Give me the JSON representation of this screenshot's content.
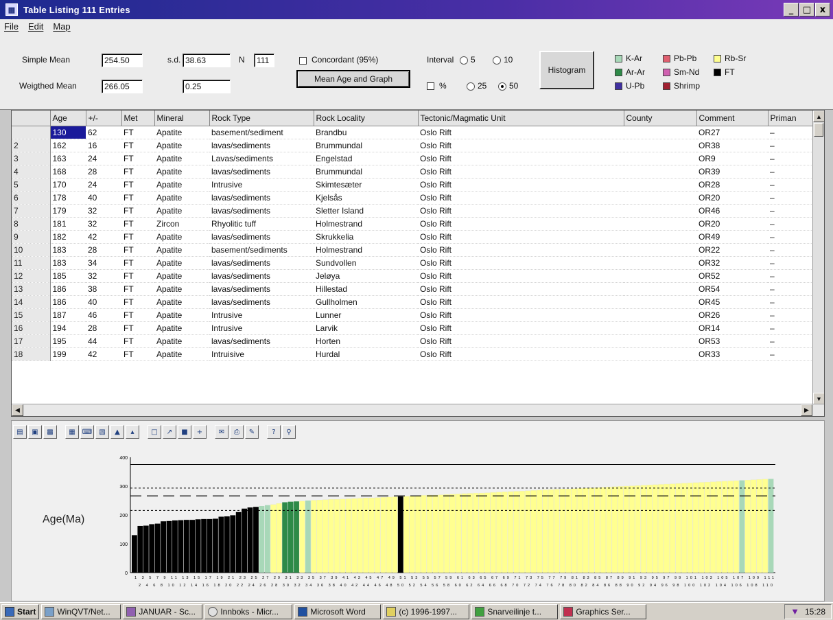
{
  "window": {
    "title": "Table Listing 111 Entries",
    "controls": [
      "_",
      "□",
      "x"
    ]
  },
  "menu": [
    "File",
    "Edit",
    "Map"
  ],
  "stats": {
    "simple_mean_label": "Simple Mean",
    "simple_mean": "254.50",
    "sd_label": "s.d.",
    "sd": "38.63",
    "n_label": "N",
    "n": "111",
    "weighted_mean_label": "Weigthed Mean",
    "weighted_mean": "266.05",
    "weighted_sd": "0.25",
    "concordant_label": "Concordant (95%)",
    "mean_button": "Mean Age and Graph"
  },
  "interval": {
    "label": "Interval",
    "opt5": "5",
    "opt10": "10",
    "opt25": "25",
    "opt50": "50",
    "percent_label": "%",
    "selected": "50"
  },
  "histogram_button": "Histogram",
  "legend": {
    "k_ar": "K-Ar",
    "pb_pb": "Pb-Pb",
    "rb_sr": "Rb-Sr",
    "ar_ar": "Ar-Ar",
    "sm_nd": "Sm-Nd",
    "ft": "FT",
    "u_pb": "U-Pb",
    "shrimp": "Shrimp",
    "colors": {
      "k_ar": "#a8d8b8",
      "pb_pb": "#e06070",
      "rb_sr": "#ffff90",
      "ar_ar": "#2e8a48",
      "sm_nd": "#d060b0",
      "ft": "#000000",
      "u_pb": "#4030a0",
      "shrimp": "#a02030"
    }
  },
  "table": {
    "headers": [
      "Age",
      "+/-",
      "Met",
      "Mineral",
      "Rock Type",
      "Rock Locality",
      "Tectonic/Magmatic Unit",
      "County",
      "Comment",
      "Priman"
    ],
    "rows": [
      [
        "",
        "130",
        "62",
        "FT",
        "Apatite",
        "basement/sediment",
        "Brandbu",
        "Oslo Rift",
        "",
        "OR27",
        "–"
      ],
      [
        "2",
        "162",
        "16",
        "FT",
        "Apatite",
        "lavas/sediments",
        "Brummundal",
        "Oslo Rift",
        "",
        "OR38",
        "–"
      ],
      [
        "3",
        "163",
        "24",
        "FT",
        "Apatite",
        "Lavas/sediments",
        "Engelstad",
        "Oslo Rift",
        "",
        "OR9",
        "–"
      ],
      [
        "4",
        "168",
        "28",
        "FT",
        "Apatite",
        "lavas/sediments",
        "Brummundal",
        "Oslo Rift",
        "",
        "OR39",
        "–"
      ],
      [
        "5",
        "170",
        "24",
        "FT",
        "Apatite",
        "Intrusive",
        "Skimtesæter",
        "Oslo Rift",
        "",
        "OR28",
        "–"
      ],
      [
        "6",
        "178",
        "40",
        "FT",
        "Apatite",
        "lavas/sediments",
        "Kjelsås",
        "Oslo Rift",
        "",
        "OR20",
        "–"
      ],
      [
        "7",
        "179",
        "32",
        "FT",
        "Apatite",
        "lavas/sediments",
        "Sletter Island",
        "Oslo Rift",
        "",
        "OR46",
        "–"
      ],
      [
        "8",
        "181",
        "32",
        "FT",
        "Zircon",
        "Rhyolitic tuff",
        "Holmestrand",
        "Oslo Rift",
        "",
        "OR20",
        "–"
      ],
      [
        "9",
        "182",
        "42",
        "FT",
        "Apatite",
        "lavas/sediments",
        "Skrukkelia",
        "Oslo Rift",
        "",
        "OR49",
        "–"
      ],
      [
        "10",
        "183",
        "28",
        "FT",
        "Apatite",
        "basement/sediments",
        "Holmestrand",
        "Oslo Rift",
        "",
        "OR22",
        "–"
      ],
      [
        "11",
        "183",
        "34",
        "FT",
        "Apatite",
        "lavas/sediments",
        "Sundvollen",
        "Oslo Rift",
        "",
        "OR32",
        "–"
      ],
      [
        "12",
        "185",
        "32",
        "FT",
        "Apatite",
        "lavas/sediments",
        "Jeløya",
        "Oslo Rift",
        "",
        "OR52",
        "–"
      ],
      [
        "13",
        "186",
        "38",
        "FT",
        "Apatite",
        "lavas/sediments",
        "Hillestad",
        "Oslo Rift",
        "",
        "OR54",
        "–"
      ],
      [
        "14",
        "186",
        "40",
        "FT",
        "Apatite",
        "lavas/sediments",
        "Gullholmen",
        "Oslo Rift",
        "",
        "OR45",
        "–"
      ],
      [
        "15",
        "187",
        "46",
        "FT",
        "Apatite",
        "Intrusive",
        "Lunner",
        "Oslo Rift",
        "",
        "OR26",
        "–"
      ],
      [
        "16",
        "194",
        "28",
        "FT",
        "Apatite",
        "Intrusive",
        "Larvik",
        "Oslo Rift",
        "",
        "OR14",
        "–"
      ],
      [
        "17",
        "195",
        "44",
        "FT",
        "Apatite",
        "lavas/sediments",
        "Horten",
        "Oslo Rift",
        "",
        "OR53",
        "–"
      ],
      [
        "18",
        "199",
        "42",
        "FT",
        "Apatite",
        "Intruisive",
        "Hurdal",
        "Oslo Rift",
        "",
        "OR33",
        "–"
      ]
    ]
  },
  "chart_data": {
    "type": "bar",
    "ylabel": "Age(Ma)",
    "ylim": [
      0,
      400
    ],
    "yticks": [
      "400",
      "300",
      "200",
      "100",
      "0"
    ],
    "x_top_labels": "1 3 5 7 9 11 13 15 17 19 21 23 25 27 29 31 33 35 37 39 41 43 45 47 49 51 53 55 57 59 61 63 65 67 69 71 73 75 77 79 81 83 85 87 89 91 93 95 97 99 101 103 105 107 109 111",
    "x_bottom_labels": "2 4 6 8 10 12 14 16 18 20 22 24 26 28 30 32 34 36 38 40 42 44 46 48 50 52 54 56 58 60 62 64 66 68 70 72 74 76 78 80 82 84 86 88 90 92 94 96 98 100 102 104 106 108 110",
    "mean_line": 254.5,
    "weighted_mean_line": 266.05,
    "sd_band": [
      215.87,
      293.13
    ],
    "reference_line": 375,
    "values": [
      130,
      162,
      163,
      168,
      170,
      178,
      179,
      181,
      182,
      183,
      183,
      185,
      186,
      186,
      187,
      194,
      195,
      199,
      210,
      222,
      226,
      228,
      231,
      234,
      236,
      240,
      244,
      246,
      247,
      248,
      250,
      251,
      252,
      253,
      254,
      254,
      255,
      256,
      257,
      258,
      259,
      259,
      260,
      261,
      262,
      263,
      264,
      265,
      266,
      267,
      268,
      269,
      269,
      270,
      271,
      272,
      273,
      274,
      275,
      276,
      276,
      277,
      278,
      279,
      280,
      281,
      282,
      283,
      284,
      285,
      286,
      287,
      288,
      289,
      290,
      290,
      291,
      292,
      293,
      294,
      295,
      296,
      297,
      298,
      299,
      300,
      301,
      302,
      303,
      304,
      305,
      306,
      307,
      308,
      309,
      310,
      311,
      312,
      313,
      314,
      315,
      316,
      317,
      318,
      319,
      320,
      321,
      322,
      323,
      324,
      325
    ],
    "methods": [
      "FT",
      "FT",
      "FT",
      "FT",
      "FT",
      "FT",
      "FT",
      "FT",
      "FT",
      "FT",
      "FT",
      "FT",
      "FT",
      "FT",
      "FT",
      "FT",
      "FT",
      "FT",
      "FT",
      "FT",
      "FT",
      "FT",
      "K-Ar",
      "K-Ar",
      "Rb-Sr",
      "Rb-Sr",
      "Ar-Ar",
      "Ar-Ar",
      "Ar-Ar",
      "Rb-Sr",
      "K-Ar",
      "Rb-Sr",
      "Rb-Sr",
      "Rb-Sr",
      "Rb-Sr",
      "Rb-Sr",
      "Rb-Sr",
      "Rb-Sr",
      "Rb-Sr",
      "Rb-Sr",
      "Rb-Sr",
      "Rb-Sr",
      "Rb-Sr",
      "Rb-Sr",
      "Rb-Sr",
      "Rb-Sr",
      "FT",
      "Rb-Sr",
      "Rb-Sr",
      "Rb-Sr",
      "Rb-Sr",
      "Rb-Sr",
      "Rb-Sr",
      "Rb-Sr",
      "Rb-Sr",
      "Rb-Sr",
      "Rb-Sr",
      "Rb-Sr",
      "Rb-Sr",
      "Rb-Sr",
      "Rb-Sr",
      "Rb-Sr",
      "Rb-Sr",
      "Rb-Sr",
      "Rb-Sr",
      "Rb-Sr",
      "Rb-Sr",
      "Rb-Sr",
      "Rb-Sr",
      "Rb-Sr",
      "Rb-Sr",
      "Rb-Sr",
      "Rb-Sr",
      "Rb-Sr",
      "Rb-Sr",
      "Rb-Sr",
      "Rb-Sr",
      "Rb-Sr",
      "Rb-Sr",
      "Rb-Sr",
      "Rb-Sr",
      "Rb-Sr",
      "Rb-Sr",
      "Rb-Sr",
      "Rb-Sr",
      "Rb-Sr",
      "Rb-Sr",
      "Rb-Sr",
      "Rb-Sr",
      "Rb-Sr",
      "Rb-Sr",
      "Rb-Sr",
      "Rb-Sr",
      "Rb-Sr",
      "Rb-Sr",
      "Rb-Sr",
      "Rb-Sr",
      "Rb-Sr",
      "Rb-Sr",
      "Rb-Sr",
      "Rb-Sr",
      "Rb-Sr",
      "Rb-Sr",
      "Rb-Sr",
      "Rb-Sr",
      "K-Ar",
      "Rb-Sr",
      "Rb-Sr",
      "Rb-Sr",
      "Rb-Sr",
      "K-Ar"
    ]
  },
  "taskbar": {
    "start": "Start",
    "items": [
      "WinQVT/Net...",
      "JANUAR - Sc...",
      "Innboks - Micr...",
      "Microsoft Word",
      "(c) 1996-1997...",
      "Snarveilinje t...",
      "Graphics Ser..."
    ],
    "clock": "15:28"
  }
}
